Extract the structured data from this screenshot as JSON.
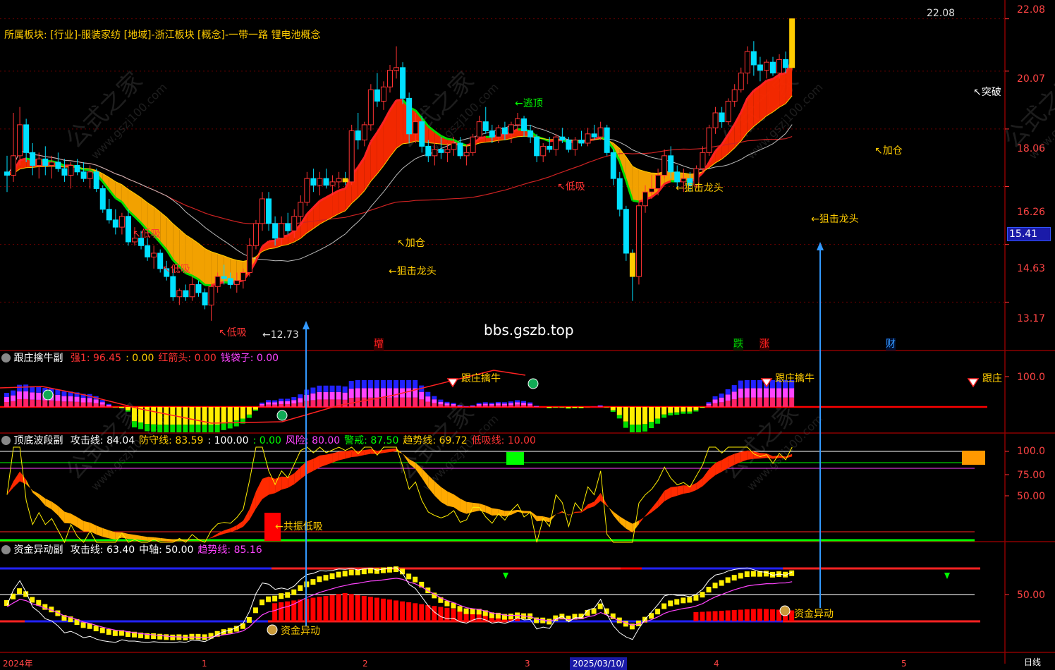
{
  "header": {
    "sector_line": "所属板块: [行业]-服装家纺 [地域]-浙江板块 [概念]-一带一路 锂电池概念"
  },
  "watermark": {
    "center_text": "bbs.gszb.top",
    "logo_text": "公式之家",
    "logo_url": "www.gszj100.com"
  },
  "main_panel": {
    "price_ticks": [
      "22.08",
      "20.07",
      "18.06",
      "16.26",
      "14.63",
      "13.17"
    ],
    "current_price": "15.41",
    "high_label": "22.08",
    "low_label": "←12.73",
    "signals": [
      {
        "text": "←逃顶",
        "color": "#00ff00"
      },
      {
        "text": "↖加仓",
        "color": "#ffcc00"
      },
      {
        "text": "←狙击龙头",
        "color": "#ffcc00"
      },
      {
        "text": "←狙击龙头",
        "color": "#ffcc00"
      },
      {
        "text": "←狙击龙头",
        "color": "#ffcc00"
      },
      {
        "text": "↖加仓",
        "color": "#ffcc00"
      },
      {
        "text": "↖突破",
        "color": "#ffffff"
      },
      {
        "text": "↖低吸",
        "color": "#ff3333"
      },
      {
        "text": "↖低吸",
        "color": "#ff3333"
      },
      {
        "text": "↖低吸",
        "color": "#ff3333"
      },
      {
        "text": "↖低吸",
        "color": "#ff3333"
      }
    ],
    "markers": [
      {
        "text": "增",
        "color": "#ff2222"
      },
      {
        "text": "跌",
        "color": "#00cc00"
      },
      {
        "text": "涨",
        "color": "#ff2222"
      },
      {
        "text": "财",
        "color": "#3399ff"
      }
    ]
  },
  "panel1": {
    "title": "跟庄擒牛副",
    "values": [
      {
        "text": "强1: 96.45",
        "color": "#ff3333"
      },
      {
        "text": ": 0.00",
        "color": "#ffcc00"
      },
      {
        "text": "红箭头: 0.00",
        "color": "#ff3333"
      },
      {
        "text": "钱袋子: 0.00",
        "color": "#ff44ff"
      }
    ],
    "tick": "100.0",
    "labels": [
      "跟庄擒牛",
      "跟庄擒牛",
      "跟庄"
    ]
  },
  "panel2": {
    "title": "顶底波段副",
    "values": [
      {
        "text": "攻击线: 84.04",
        "color": "#ffffff"
      },
      {
        "text": "防守线: 83.59",
        "color": "#ffcc00"
      },
      {
        "text": ": 100.00",
        "color": "#ffffff"
      },
      {
        "text": ": 0.00",
        "color": "#00ff00"
      },
      {
        "text": "风险: 80.00",
        "color": "#ff44ff"
      },
      {
        "text": "警戒: 87.50",
        "color": "#00ff00"
      },
      {
        "text": "趋势线: 69.72",
        "color": "#ffcc00"
      },
      {
        "text": "低吸线: 10.00",
        "color": "#ff3333"
      }
    ],
    "ticks": [
      "100.0",
      "75.00",
      "50.00"
    ],
    "label": "←共振低吸"
  },
  "panel3": {
    "title": "资金异动副",
    "values": [
      {
        "text": "攻击线: 63.40",
        "color": "#ffffff"
      },
      {
        "text": "中轴: 50.00",
        "color": "#ffffff"
      },
      {
        "text": "趋势线: 85.16",
        "color": "#ff44ff"
      }
    ],
    "tick": "50.00",
    "labels": [
      "资金异动",
      "资金异动"
    ]
  },
  "date_axis": {
    "labels": [
      "2024年",
      "1",
      "2",
      "3",
      "2025/03/10/",
      "4",
      "5"
    ],
    "corner": "日线"
  },
  "chart_data": {
    "type": "candlestick",
    "y_scale": "log",
    "ylim": [
      12.5,
      22.5
    ],
    "price_ticks": [
      22.08,
      20.07,
      18.06,
      16.26,
      14.63,
      13.17
    ],
    "candles": [
      [
        16.7,
        17.2,
        16.1,
        16.6
      ],
      [
        16.6,
        18.6,
        16.4,
        17.2
      ],
      [
        17.2,
        18.8,
        16.9,
        18.2
      ],
      [
        18.2,
        18.4,
        17.0,
        17.3
      ],
      [
        17.3,
        17.6,
        16.6,
        16.9
      ],
      [
        16.9,
        17.3,
        16.5,
        17.1
      ],
      [
        17.1,
        17.5,
        16.6,
        16.9
      ],
      [
        16.9,
        17.2,
        16.5,
        17.0
      ],
      [
        17.0,
        17.3,
        16.7,
        16.8
      ],
      [
        16.8,
        17.1,
        16.4,
        16.6
      ],
      [
        16.6,
        17.0,
        16.2,
        16.9
      ],
      [
        16.9,
        17.1,
        16.6,
        16.7
      ],
      [
        16.7,
        17.0,
        16.4,
        16.5
      ],
      [
        16.5,
        16.9,
        16.2,
        16.7
      ],
      [
        16.7,
        16.8,
        16.1,
        16.2
      ],
      [
        16.2,
        16.3,
        15.5,
        15.6
      ],
      [
        15.6,
        15.9,
        15.2,
        15.3
      ],
      [
        15.3,
        15.6,
        14.9,
        15.1
      ],
      [
        15.1,
        15.5,
        14.9,
        15.4
      ],
      [
        15.4,
        15.6,
        14.6,
        14.7
      ],
      [
        14.7,
        15.1,
        14.6,
        14.8
      ],
      [
        14.8,
        15.0,
        14.5,
        14.6
      ],
      [
        14.6,
        14.8,
        14.2,
        14.3
      ],
      [
        14.3,
        14.6,
        14.0,
        14.4
      ],
      [
        14.4,
        14.5,
        13.9,
        14.0
      ],
      [
        14.0,
        14.2,
        13.7,
        13.8
      ],
      [
        13.8,
        14.0,
        13.2,
        13.3
      ],
      [
        13.3,
        13.5,
        13.1,
        13.45
      ],
      [
        13.45,
        13.6,
        13.2,
        13.3
      ],
      [
        13.3,
        13.8,
        13.2,
        13.6
      ],
      [
        13.6,
        13.7,
        13.3,
        13.4
      ],
      [
        13.4,
        13.5,
        13.0,
        13.1
      ],
      [
        13.1,
        13.6,
        12.73,
        13.55
      ],
      [
        13.55,
        13.9,
        13.4,
        13.8
      ],
      [
        13.8,
        14.1,
        13.6,
        13.75
      ],
      [
        13.75,
        13.9,
        13.5,
        13.6
      ],
      [
        13.6,
        13.9,
        13.4,
        13.7
      ],
      [
        13.7,
        14.0,
        13.5,
        13.9
      ],
      [
        13.9,
        14.8,
        13.8,
        14.6
      ],
      [
        14.6,
        15.3,
        14.5,
        15.2
      ],
      [
        15.2,
        16.1,
        15.0,
        15.9
      ],
      [
        15.9,
        16.1,
        15.0,
        15.2
      ],
      [
        15.2,
        15.4,
        14.6,
        14.8
      ],
      [
        14.8,
        15.4,
        14.6,
        15.2
      ],
      [
        15.2,
        15.5,
        14.9,
        15.0
      ],
      [
        15.0,
        15.6,
        14.8,
        15.4
      ],
      [
        15.4,
        16.0,
        15.2,
        15.8
      ],
      [
        15.8,
        16.7,
        15.7,
        16.5
      ],
      [
        16.5,
        16.8,
        16.1,
        16.3
      ],
      [
        16.3,
        16.7,
        16.0,
        16.5
      ],
      [
        16.5,
        16.8,
        16.2,
        16.3
      ],
      [
        16.3,
        16.6,
        16.0,
        16.4
      ],
      [
        16.4,
        16.7,
        16.2,
        16.5
      ],
      [
        16.5,
        16.7,
        16.3,
        16.4
      ],
      [
        16.4,
        18.2,
        16.3,
        18.0
      ],
      [
        18.0,
        18.6,
        17.4,
        17.7
      ],
      [
        17.7,
        18.3,
        17.5,
        18.2
      ],
      [
        18.2,
        19.6,
        18.0,
        19.4
      ],
      [
        19.4,
        20.0,
        18.8,
        19.0
      ],
      [
        19.0,
        19.7,
        18.7,
        19.5
      ],
      [
        19.5,
        20.3,
        19.3,
        20.1
      ],
      [
        20.1,
        21.0,
        19.8,
        20.2
      ],
      [
        20.2,
        20.4,
        18.9,
        19.1
      ],
      [
        19.1,
        19.3,
        17.6,
        17.9
      ],
      [
        17.9,
        18.6,
        17.6,
        18.3
      ],
      [
        18.3,
        18.5,
        17.3,
        17.5
      ],
      [
        17.5,
        17.7,
        17.0,
        17.2
      ],
      [
        17.2,
        17.6,
        16.9,
        17.4
      ],
      [
        17.4,
        17.8,
        17.1,
        17.3
      ],
      [
        17.3,
        17.6,
        17.0,
        17.4
      ],
      [
        17.4,
        17.8,
        17.2,
        17.6
      ],
      [
        17.6,
        17.8,
        17.1,
        17.2
      ],
      [
        17.2,
        17.5,
        16.9,
        17.3
      ],
      [
        17.3,
        17.9,
        17.2,
        17.8
      ],
      [
        17.8,
        18.5,
        17.7,
        18.3
      ],
      [
        18.3,
        18.8,
        17.9,
        18.0
      ],
      [
        18.0,
        18.2,
        17.6,
        17.8
      ],
      [
        17.8,
        18.2,
        17.6,
        18.1
      ],
      [
        18.1,
        18.3,
        17.7,
        17.9
      ],
      [
        17.9,
        18.3,
        17.6,
        18.2
      ],
      [
        18.2,
        18.6,
        18.0,
        18.4
      ],
      [
        18.4,
        18.5,
        17.8,
        18.0
      ],
      [
        18.0,
        18.2,
        17.6,
        17.8
      ],
      [
        17.8,
        17.9,
        17.0,
        17.2
      ],
      [
        17.2,
        17.6,
        17.0,
        17.5
      ],
      [
        17.5,
        17.8,
        17.3,
        17.4
      ],
      [
        17.4,
        17.9,
        17.2,
        17.8
      ],
      [
        17.8,
        18.1,
        17.6,
        17.7
      ],
      [
        17.7,
        17.8,
        17.3,
        17.4
      ],
      [
        17.4,
        17.8,
        17.2,
        17.7
      ],
      [
        17.7,
        18.0,
        17.5,
        17.6
      ],
      [
        17.6,
        18.1,
        17.5,
        17.9
      ],
      [
        17.9,
        18.2,
        17.7,
        17.8
      ],
      [
        17.8,
        18.3,
        17.7,
        18.1
      ],
      [
        18.1,
        18.2,
        17.2,
        17.3
      ],
      [
        17.3,
        17.4,
        16.3,
        16.5
      ],
      [
        16.5,
        16.7,
        15.4,
        15.6
      ],
      [
        15.6,
        15.7,
        14.2,
        14.4
      ],
      [
        14.4,
        14.5,
        13.2,
        13.8
      ],
      [
        13.8,
        15.8,
        13.6,
        15.7
      ],
      [
        15.7,
        16.3,
        15.5,
        16.1
      ],
      [
        16.1,
        16.6,
        15.9,
        16.2
      ],
      [
        16.2,
        16.8,
        16.0,
        16.6
      ],
      [
        16.6,
        17.4,
        16.5,
        17.2
      ],
      [
        17.2,
        17.5,
        16.5,
        16.7
      ],
      [
        16.7,
        16.9,
        16.2,
        16.4
      ],
      [
        16.4,
        16.8,
        16.1,
        16.5
      ],
      [
        16.5,
        16.7,
        16.1,
        16.3
      ],
      [
        16.3,
        16.9,
        16.2,
        16.8
      ],
      [
        16.8,
        17.5,
        16.7,
        17.3
      ],
      [
        17.3,
        18.2,
        17.2,
        18.1
      ],
      [
        18.1,
        18.8,
        17.9,
        18.6
      ],
      [
        18.6,
        18.8,
        18.1,
        18.3
      ],
      [
        18.3,
        19.1,
        18.2,
        19.0
      ],
      [
        19.0,
        19.6,
        18.8,
        19.4
      ],
      [
        19.4,
        20.2,
        19.3,
        20.0
      ],
      [
        20.0,
        21.0,
        19.6,
        20.8
      ],
      [
        20.8,
        21.2,
        19.9,
        20.3
      ],
      [
        20.3,
        20.6,
        19.7,
        20.1
      ],
      [
        20.1,
        20.5,
        19.8,
        20.4
      ],
      [
        20.4,
        20.6,
        19.9,
        20.0
      ],
      [
        20.0,
        20.7,
        19.8,
        20.5
      ],
      [
        20.5,
        20.8,
        20.0,
        20.2
      ],
      [
        20.2,
        22.08,
        20.1,
        22.08
      ]
    ],
    "series": [
      {
        "name": "攻击线",
        "color": "#ff2222"
      },
      {
        "name": "防守线",
        "color": "#ffcc00"
      },
      {
        "name": "趋势线",
        "color": "#ff44ff"
      },
      {
        "name": "钱袋子",
        "color": "#ff44ff"
      }
    ]
  },
  "colors": {
    "up": "#ff3333",
    "down": "#00e0ff",
    "grid": "#8b0000",
    "axis_text": "#ff4444",
    "yellow": "#ffcc00",
    "green": "#00ff00"
  }
}
